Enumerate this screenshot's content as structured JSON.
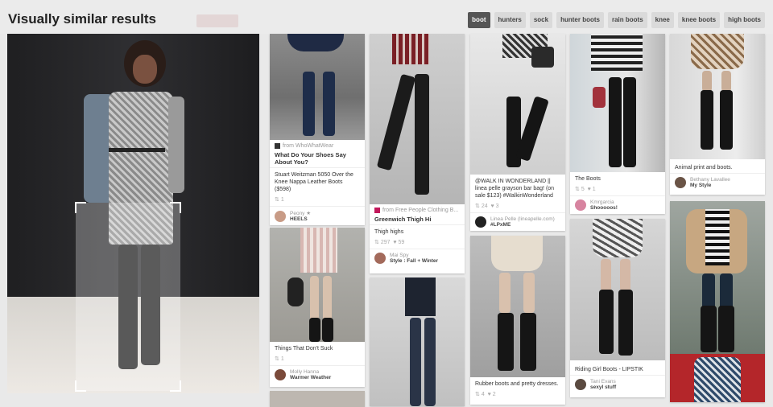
{
  "header": {
    "title": "Visually similar results",
    "tags": [
      "boot",
      "hunters",
      "sock",
      "hunter boots",
      "rain boots",
      "knee",
      "knee boots",
      "high boots"
    ],
    "active_tag": "boot"
  },
  "colors": {
    "accent": "#555555",
    "page_bg": "#e9e9e9",
    "card_bg": "#ffffff"
  },
  "pins": {
    "p1": {
      "source": "from WhoWhatWear",
      "heading": "What Do Your Shoes Say About You?",
      "desc": "Stuart Weitzman 5050 Over the Knee Nappa Leather Boots ($598)",
      "stats": "1",
      "user1": "Peony",
      "user2": "HEELS"
    },
    "p2": {
      "desc": "Things That Don't Suck",
      "stats": "1",
      "user1": "Molly Hanna",
      "user2": "Warmer Weather"
    },
    "p3": {
      "source": "from Free People Clothing B...",
      "heading": "Greenwich Thigh Hi",
      "desc": "Thigh highs",
      "stats_repins": "297",
      "stats_likes": "59",
      "user1": "Mai Spy",
      "user2": "Style : Fall + Winter"
    },
    "p4": {
      "desc": "@WALK IN WONDERLAND || linea pelle grayson bar bag! (on sale $123) #WalkinWonderland",
      "stats_repins": "24",
      "stats_likes": "3",
      "user1": "Linea Pelle (lineapelle.com)",
      "user2": "#LPxME"
    },
    "p5": {
      "desc": "Rubber boots and pretty dresses.",
      "stats_repins": "4",
      "stats_likes": "2"
    },
    "p6": {
      "desc": "The Boots",
      "stats_repins": "5",
      "stats_likes": "1",
      "user1": "Kmrgarcia",
      "user2": "Shooooos!"
    },
    "p7": {
      "desc": "Riding Girl Boots - LIPSTIK",
      "user1": "Tani Evans",
      "user2": "sexyl stuff"
    },
    "p8": {
      "desc": "Animal print and boots.",
      "user1": "Bethany Lavallee",
      "user2": "My Style"
    }
  }
}
